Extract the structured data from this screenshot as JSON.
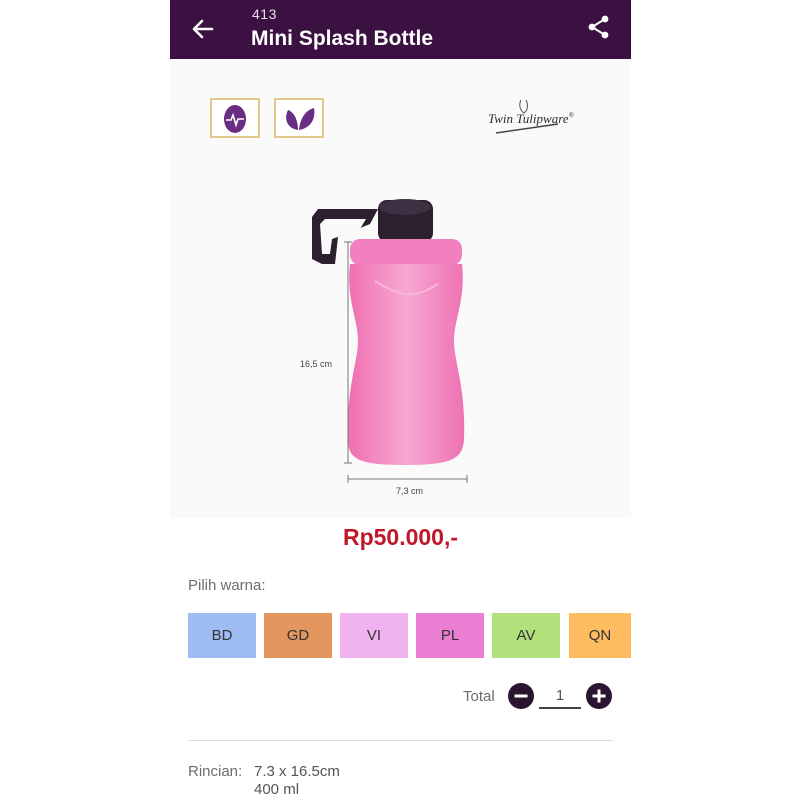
{
  "header": {
    "product_code": "413",
    "title": "Mini Splash Bottle",
    "back_icon": "arrow-left-icon",
    "share_icon": "share-icon"
  },
  "product_image": {
    "badges": [
      "egg-heartbeat-icon",
      "leaf-icon"
    ],
    "brand_logo": "Twin Tulipware",
    "height_label": "16,5 cm",
    "width_label": "7,3 cm",
    "bottle_color": "#f287c0",
    "cap_color": "#2c1f2e"
  },
  "price": "Rp50.000,-",
  "color_picker": {
    "label": "Pilih warna:",
    "options": [
      {
        "code": "BD",
        "color": "#9fbdf2"
      },
      {
        "code": "GD",
        "color": "#e3965e"
      },
      {
        "code": "VI",
        "color": "#f1b3ef"
      },
      {
        "code": "PL",
        "color": "#ea7ed2"
      },
      {
        "code": "AV",
        "color": "#b2e07a"
      },
      {
        "code": "QN",
        "color": "#fdbc60"
      }
    ]
  },
  "quantity": {
    "label": "Total",
    "value": "1"
  },
  "details": {
    "label": "Rincian:",
    "lines": [
      "7.3 x 16.5cm",
      "400 ml"
    ]
  },
  "colors": {
    "appbar": "#3a1141",
    "price": "#c0172a"
  }
}
